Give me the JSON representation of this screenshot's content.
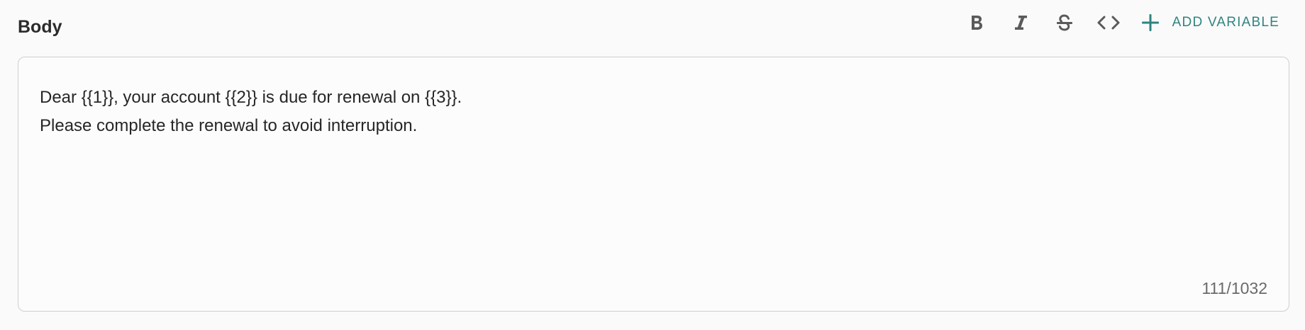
{
  "field": {
    "label": "Body"
  },
  "toolbar": {
    "bold_icon": "bold-icon",
    "italic_icon": "italic-icon",
    "strikethrough_icon": "strikethrough-icon",
    "code_icon": "code-icon",
    "add_variable_icon": "plus-icon",
    "add_variable_label": "ADD VARIABLE",
    "accent_color": "#2f8480"
  },
  "editor": {
    "lines": [
      "Dear {{1}}, your account {{2}} is due for renewal on {{3}}.",
      "Please complete the renewal to avoid interruption."
    ],
    "char_count": "111/1032"
  }
}
